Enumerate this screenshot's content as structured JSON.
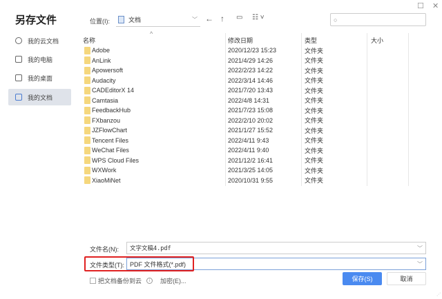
{
  "title": "另存文件",
  "sidebar": {
    "items": [
      {
        "label": "我的云文档"
      },
      {
        "label": "我的电脑"
      },
      {
        "label": "我的桌面"
      },
      {
        "label": "我的文档"
      }
    ]
  },
  "location": {
    "label": "位置(I):",
    "value": "文档"
  },
  "search": {
    "placeholder": ""
  },
  "columns": {
    "name": "名称",
    "date": "修改日期",
    "type": "类型",
    "size": "大小"
  },
  "files": [
    {
      "name": "Adobe",
      "date": "2020/12/23 15:23",
      "type": "文件夹"
    },
    {
      "name": "AnLink",
      "date": "2021/4/29 14:26",
      "type": "文件夹"
    },
    {
      "name": "Apowersoft",
      "date": "2022/2/23 14:22",
      "type": "文件夹"
    },
    {
      "name": "Audacity",
      "date": "2022/3/14 14:46",
      "type": "文件夹"
    },
    {
      "name": "CADEditorX 14",
      "date": "2021/7/20 13:43",
      "type": "文件夹"
    },
    {
      "name": "Camtasia",
      "date": "2022/4/8 14:31",
      "type": "文件夹"
    },
    {
      "name": "FeedbackHub",
      "date": "2021/7/23 15:08",
      "type": "文件夹"
    },
    {
      "name": "FXbanzou",
      "date": "2022/2/10 20:02",
      "type": "文件夹"
    },
    {
      "name": "JZFlowChart",
      "date": "2021/1/27 15:52",
      "type": "文件夹"
    },
    {
      "name": "Tencent Files",
      "date": "2022/4/11 9:43",
      "type": "文件夹"
    },
    {
      "name": "WeChat Files",
      "date": "2022/4/11 9:40",
      "type": "文件夹"
    },
    {
      "name": "WPS Cloud Files",
      "date": "2021/12/2 16:41",
      "type": "文件夹"
    },
    {
      "name": "WXWork",
      "date": "2021/3/25 14:05",
      "type": "文件夹"
    },
    {
      "name": "XiaoMiNet",
      "date": "2020/10/31 9:55",
      "type": "文件夹"
    }
  ],
  "filename": {
    "label": "文件名(N):",
    "value": "文字文稿4.pdf"
  },
  "filetype": {
    "label": "文件类型(T):",
    "value": "PDF 文件格式(*.pdf)"
  },
  "backup": {
    "label": "把文档备份到云"
  },
  "encrypt": {
    "label": "加密(E)..."
  },
  "buttons": {
    "save": "保存(S)",
    "cancel": "取消"
  }
}
